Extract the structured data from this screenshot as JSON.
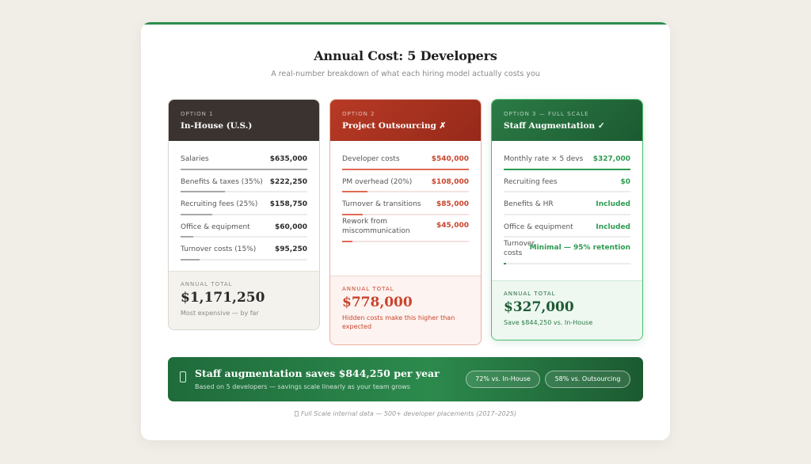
{
  "header": {
    "title": "Annual Cost: 5 Developers",
    "subtitle": "A real-number breakdown of what each hiring model actually costs you"
  },
  "options": [
    {
      "label": "OPTION 1",
      "name": "In-House (U.S.)",
      "rows": [
        {
          "label": "Salaries",
          "value": "$635,000",
          "share": 1.0
        },
        {
          "label": "Benefits & taxes (35%)",
          "value": "$222,250",
          "share": 0.35
        },
        {
          "label": "Recruiting fees (25%)",
          "value": "$158,750",
          "share": 0.25
        },
        {
          "label": "Office & equipment",
          "value": "$60,000",
          "share": 0.1
        },
        {
          "label": "Turnover costs (15%)",
          "value": "$95,250",
          "share": 0.15
        }
      ],
      "total_label": "ANNUAL TOTAL",
      "total_value": "$1,171,250",
      "total_note": "Most expensive — by far"
    },
    {
      "label": "OPTION 2",
      "name": "Project Outsourcing ✗",
      "rows": [
        {
          "label": "Developer costs",
          "value": "$540,000",
          "share": 1.0
        },
        {
          "label": "PM overhead (20%)",
          "value": "$108,000",
          "share": 0.2
        },
        {
          "label": "Turnover & transitions",
          "value": "$85,000",
          "share": 0.16
        },
        {
          "label": "Rework from miscommunication",
          "value": "$45,000",
          "share": 0.08
        }
      ],
      "total_label": "ANNUAL TOTAL",
      "total_value": "$778,000",
      "total_note": "Hidden costs make this higher than expected"
    },
    {
      "label": "OPTION 3 — FULL SCALE",
      "name": "Staff Augmentation ✓",
      "rows": [
        {
          "label": "Monthly rate × 5 devs",
          "value": "$327,000",
          "share": 1.0
        },
        {
          "label": "Recruiting fees",
          "value": "$0",
          "share": 0
        },
        {
          "label": "Benefits & HR",
          "value": "Included",
          "share": 0
        },
        {
          "label": "Office & equipment",
          "value": "Included",
          "share": 0
        },
        {
          "label": "Turnover costs",
          "value": "Minimal — 95% retention",
          "share": 0.02
        }
      ],
      "total_label": "ANNUAL TOTAL",
      "total_value": "$327,000",
      "total_note": "Save $844,250 vs. In-House"
    }
  ],
  "banner": {
    "icon": "lightbulb-icon",
    "title": "Staff augmentation saves $844,250 per year",
    "subtitle": "Based on 5 developers — savings scale linearly as your team grows",
    "pill_inhouse": "72% vs. In-House",
    "pill_outsourcing": "58% vs. Outsourcing"
  },
  "footnote": "Full Scale internal data — 500+ developer placements (2017–2025)",
  "colors": {
    "accent_green": "#2d8c4e",
    "outsourcing_red": "#c9452c",
    "inhouse_dark": "#3a3330"
  }
}
